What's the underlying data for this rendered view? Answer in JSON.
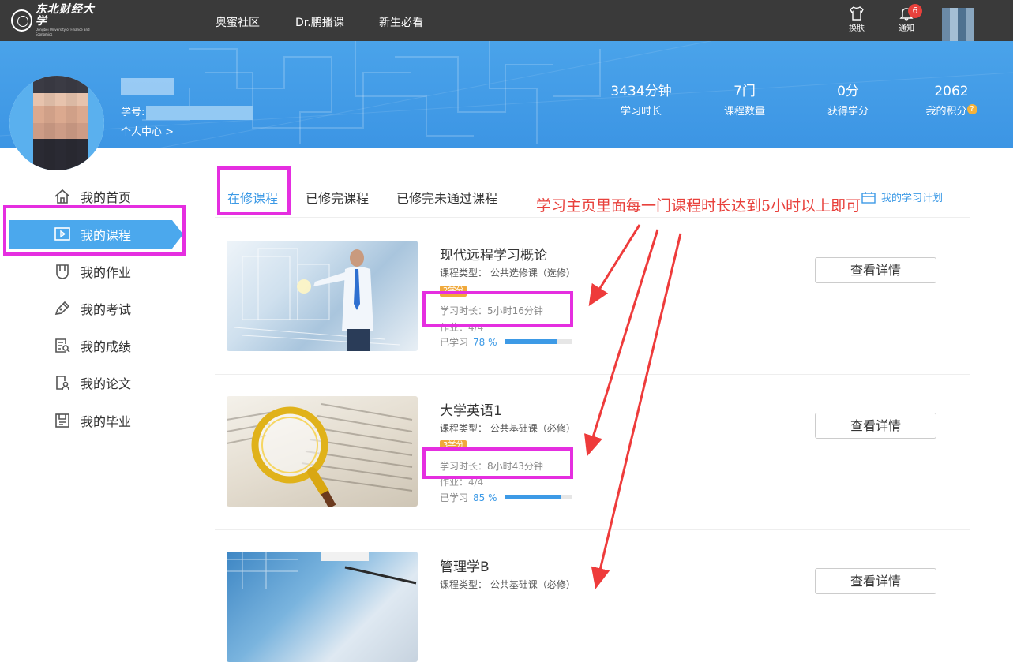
{
  "header": {
    "logo": {
      "cn": "东北财经大学",
      "en": "Dongbei University of Finance and Economics"
    },
    "nav": [
      "奥蜜社区",
      "Dr.鹏播课",
      "新生必看"
    ],
    "skin_label": "换肤",
    "notify_label": "通知",
    "notify_count": "6",
    "icons": {
      "skin": "shirt-icon",
      "notify": "bell-icon"
    }
  },
  "profile": {
    "id_label": "学号:",
    "center_link": "个人中心 >",
    "stats": [
      {
        "value": "3434分钟",
        "label": "学习时长"
      },
      {
        "value": "7门",
        "label": "课程数量"
      },
      {
        "value": "0分",
        "label": "获得学分"
      },
      {
        "value": "2062",
        "label": "我的积分"
      }
    ],
    "points_help": "?"
  },
  "sidebar": {
    "items": [
      {
        "label": "我的首页",
        "icon": "home-icon"
      },
      {
        "label": "我的课程",
        "icon": "course-icon",
        "active": true
      },
      {
        "label": "我的作业",
        "icon": "homework-icon"
      },
      {
        "label": "我的考试",
        "icon": "exam-icon"
      },
      {
        "label": "我的成绩",
        "icon": "grades-icon"
      },
      {
        "label": "我的论文",
        "icon": "thesis-icon"
      },
      {
        "label": "我的毕业",
        "icon": "graduation-icon"
      }
    ]
  },
  "tabs": [
    "在修课程",
    "已修完课程",
    "已修完未通过课程"
  ],
  "plan_link": "我的学习计划",
  "annotation": "学习主页里面每一门课程时长达到5小时以上即可",
  "courses": [
    {
      "name": "现代远程学习概论",
      "type": "课程类型： 公共选修课（选修）",
      "credit": "2学分",
      "time": "学习时长：5小时16分钟",
      "homework": "作业：4/4",
      "progress_label": "已学习",
      "progress_text": "78 %",
      "progress": 78,
      "button": "查看详情"
    },
    {
      "name": "大学英语1",
      "type": "课程类型： 公共基础课（必修）",
      "credit": "3学分",
      "time": "学习时长：8小时43分钟",
      "homework": "作业：4/4",
      "progress_label": "已学习",
      "progress_text": "85 %",
      "progress": 85,
      "button": "查看详情"
    },
    {
      "name": "管理学B",
      "type": "课程类型： 公共基础课（必修）",
      "button": "查看详情"
    }
  ],
  "colors": {
    "accent": "#3d9ae6",
    "topbar": "#3a3a3a",
    "highlight": "#e52ee0",
    "annotation": "#e8413c",
    "credit": "#f0a93b"
  }
}
